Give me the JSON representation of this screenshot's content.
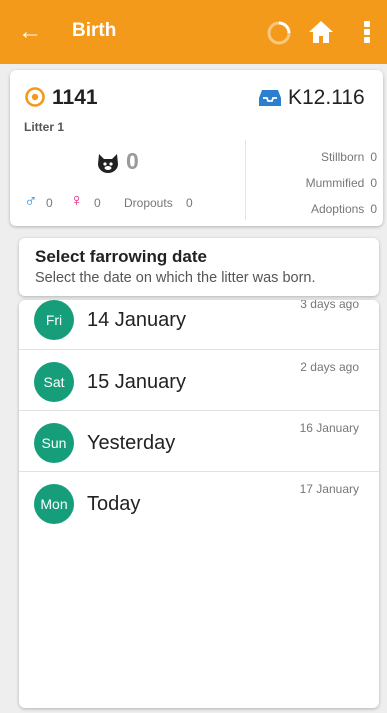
{
  "appbar": {
    "title": "Birth",
    "back_icon": "arrow-left-icon",
    "icons": [
      "loading-spinner-icon",
      "home-icon",
      "more-vert-icon"
    ],
    "color": "#f39a1b"
  },
  "summary": {
    "sow_id": "1141",
    "pen": "K12.116",
    "litter": "Litter 1",
    "piglets": "0",
    "male_count": "0",
    "female_count": "0",
    "dropouts_label": "Dropouts",
    "dropouts_count": "0",
    "stats": [
      {
        "label": "Stillborn",
        "value": "0"
      },
      {
        "label": "Mummified",
        "value": "0"
      },
      {
        "label": "Adoptions",
        "value": "0"
      }
    ]
  },
  "select": {
    "title": "Select farrowing date",
    "subtitle": "Select the date on which the litter was born."
  },
  "dates": [
    {
      "day": "Fri",
      "date": "14 January",
      "ago": "3 days ago"
    },
    {
      "day": "Sat",
      "date": "15 January",
      "ago": "2 days ago"
    },
    {
      "day": "Sun",
      "date": "Yesterday",
      "ago": "16 January"
    },
    {
      "day": "Mon",
      "date": "Today",
      "ago": "17 January"
    }
  ],
  "colors": {
    "accent": "#f39a1b",
    "day_badge": "#169e7b",
    "male": "#2a8fd8",
    "female": "#e0207a"
  }
}
